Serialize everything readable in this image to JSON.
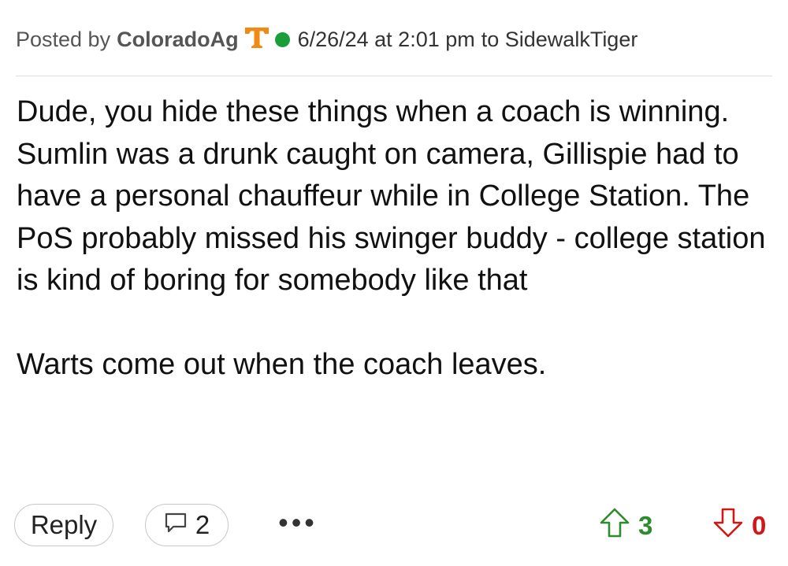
{
  "header": {
    "posted_by_label": "Posted by",
    "username": "ColoradoAg",
    "team_logo_icon": "tennessee-power-t-icon",
    "team_logo_letter": "T",
    "online_status": "online",
    "timestamp": "6/26/24 at 2:01 pm",
    "reply_to": "to SidewalkTiger"
  },
  "body": {
    "paragraphs": [
      "Dude, you hide these things when a coach is winning. Sumlin was a drunk caught on camera, Gillispie had to have a personal chauffeur while in College Station. The PoS probably missed his swinger buddy - college station is kind of boring for somebody like that",
      "Warts come out when the coach leaves."
    ]
  },
  "actions": {
    "reply_label": "Reply",
    "comment_count": "2",
    "more_label": "•••",
    "upvotes": "3",
    "downvotes": "0"
  },
  "colors": {
    "team_orange": "#f08a12",
    "online_green": "#1a9e3a",
    "upvote_green": "#2e8b2e",
    "downvote_red": "#d01818"
  },
  "icons": {
    "comment": "speech-bubble-icon",
    "upvote": "up-arrow-outline-icon",
    "downvote": "down-arrow-outline-icon",
    "more": "ellipsis-icon"
  }
}
